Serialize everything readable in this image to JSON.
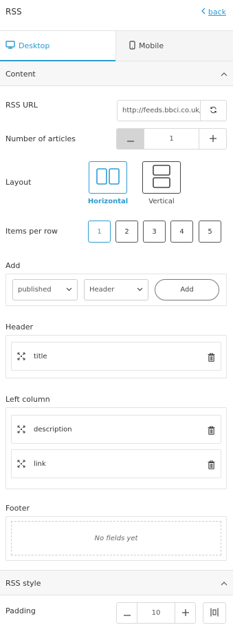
{
  "header": {
    "title": "RSS",
    "back_label": "back"
  },
  "tabs": [
    {
      "label": "Desktop"
    },
    {
      "label": "Mobile"
    }
  ],
  "content_section": {
    "title": "Content"
  },
  "rss_url": {
    "label": "RSS URL",
    "value": "http://feeds.bbci.co.uk/news/rss.xml"
  },
  "articles": {
    "label": "Number of articles",
    "value": "1"
  },
  "layout": {
    "label": "Layout",
    "options": [
      {
        "label": "Horizontal"
      },
      {
        "label": "Vertical"
      }
    ],
    "selected": "Horizontal"
  },
  "items_per_row": {
    "label": "Items per row",
    "options": [
      "1",
      "2",
      "3",
      "4",
      "5"
    ],
    "selected": "1"
  },
  "add": {
    "label": "Add",
    "field_select": "published",
    "target_select": "Header",
    "button_label": "Add"
  },
  "header_group": {
    "label": "Header",
    "fields": [
      {
        "name": "title"
      }
    ]
  },
  "left_column": {
    "label": "Left column",
    "fields": [
      {
        "name": "description"
      },
      {
        "name": "link"
      }
    ]
  },
  "footer": {
    "label": "Footer",
    "empty_text": "No fields yet"
  },
  "style_section": {
    "title": "RSS style"
  },
  "padding": {
    "label": "Padding",
    "value": "10"
  },
  "colors": {
    "accent": "#2b9bd1",
    "border": "#e3e3e3",
    "stepper_minus_bg": "#d4d4d4"
  }
}
